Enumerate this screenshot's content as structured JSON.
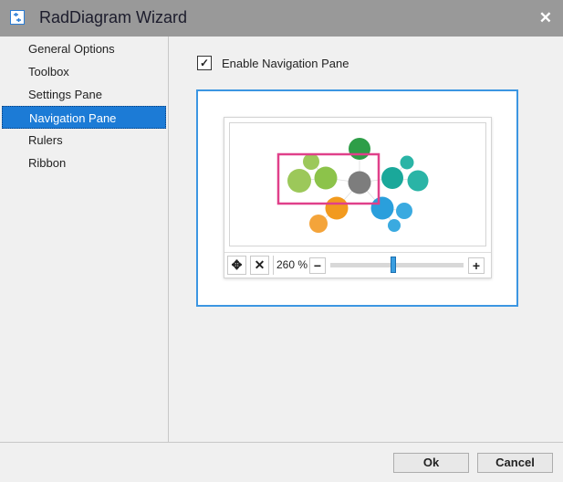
{
  "window": {
    "title": "RadDiagram Wizard",
    "close_icon": "close-icon"
  },
  "sidebar": {
    "items": [
      {
        "label": "General Options"
      },
      {
        "label": "Toolbox"
      },
      {
        "label": "Settings Pane"
      },
      {
        "label": "Navigation Pane",
        "selected": true
      },
      {
        "label": "Rulers"
      },
      {
        "label": "Ribbon"
      }
    ]
  },
  "main": {
    "enable_label": "Enable Navigation Pane",
    "enabled": true,
    "checkmark": "✓"
  },
  "navigation_pane": {
    "zoom_text": "260 %",
    "zoom_fraction": 0.47,
    "minus": "−",
    "plus": "+",
    "pan_icon": "move-icon",
    "fit_icon": "close-icon"
  },
  "colors": {
    "accent": "#1c7bd6",
    "viewport": "#e0408a",
    "green_dark": "#2e9e48",
    "green_light": "#8cc34a",
    "gray": "#7d7d7d",
    "teal": "#1aa89a",
    "orange": "#f29a1e",
    "blue": "#2a9fdc"
  },
  "footer": {
    "ok": "Ok",
    "cancel": "Cancel"
  }
}
